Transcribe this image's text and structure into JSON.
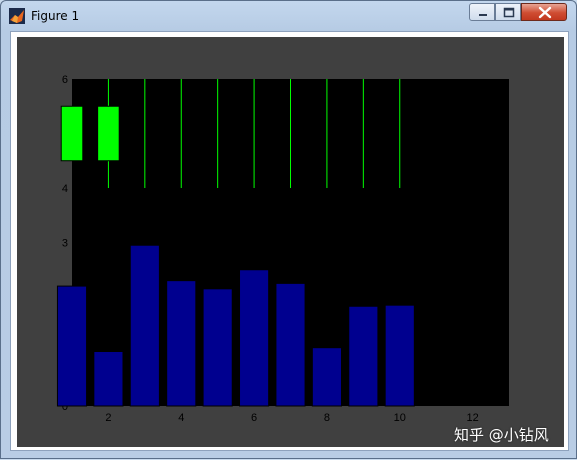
{
  "window": {
    "title": "Figure 1",
    "icon": "matlab-icon",
    "controls": [
      "minimize-icon",
      "maximize-icon",
      "close-icon"
    ]
  },
  "chart_data": {
    "type": "bar",
    "xlim": [
      1,
      13
    ],
    "ylim": [
      0,
      6
    ],
    "xticks": [
      2,
      4,
      6,
      8,
      10,
      12
    ],
    "yticks": [
      0,
      1,
      2,
      3,
      4,
      5,
      6
    ],
    "grid": false,
    "bar_color": "#00008f",
    "axes_color": "#000000",
    "figure_color": "#404040",
    "series": [
      {
        "bars_x": [
          1,
          2,
          3,
          4,
          5,
          6,
          7,
          8,
          9,
          10
        ],
        "values": [
          2.2,
          1.0,
          2.95,
          2.3,
          2.15,
          2.5,
          2.25,
          1.07,
          1.83,
          1.85
        ]
      }
    ],
    "green_lines": {
      "color": "#00ff00",
      "x": [
        2,
        3,
        4,
        5,
        6,
        7,
        8,
        9,
        10
      ],
      "y_range": [
        4,
        6
      ]
    },
    "green_boxes": {
      "color": "#00ff00",
      "x_centers": [
        1,
        2
      ],
      "y_range": [
        4.5,
        5.5
      ]
    }
  },
  "watermark": "知乎 @小钻风"
}
